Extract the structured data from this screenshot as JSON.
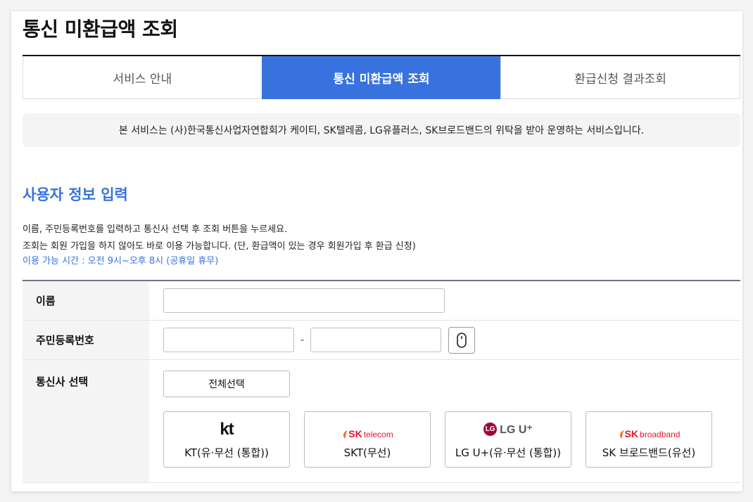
{
  "page": {
    "title": "통신 미환급액 조회"
  },
  "tabs": [
    {
      "label": "서비스 안내"
    },
    {
      "label": "통신 미환급액 조회"
    },
    {
      "label": "환급신청 결과조회"
    }
  ],
  "notice": "본 서비스는 (사)한국통신사업자연합회가 케이티, SK텔레콤, LG유플러스, SK브로드밴드의 위탁을 받아 운영하는 서비스입니다.",
  "section": {
    "title": "사용자 정보 입력",
    "line1": "이름, 주민등록번호를 입력하고 통신사 선택 후 조회 버튼을 누르세요.",
    "line2": "조회는 회원 가입을 하지 않아도 바로 이용 가능합니다. (단, 환급액이 있는 경우 회원가입 후 환급 신청)",
    "hours": "이용 가능 시간 : 오전 9시~오후 8시 (공휴일 휴무)"
  },
  "form": {
    "name_label": "이름",
    "name_value": "",
    "rrn_label": "주민등록번호",
    "rrn_front_value": "",
    "rrn_back_value": "",
    "rrn_separator": "-",
    "carrier_label": "통신사 선택",
    "select_all": "전체선택"
  },
  "carriers": [
    {
      "logo": "kt",
      "logo_text": "kt",
      "label": "KT(유·무선 (통합))"
    },
    {
      "logo": "sk-telecom",
      "logo_text": "SK",
      "logo_sub": "telecom",
      "label": "SKT(무선)"
    },
    {
      "logo": "lg-uplus",
      "logo_text": "LG U⁺",
      "logo_mark": "LG",
      "label": "LG U+(유·무선 (통합))"
    },
    {
      "logo": "sk-broadband",
      "logo_text": "SK",
      "logo_sub": "broadband",
      "label": "SK 브로드밴드(유선)"
    }
  ],
  "colors": {
    "accent": "#3872de",
    "kt": "#111111",
    "sk": "#e0182d",
    "lg": "#a50034"
  }
}
